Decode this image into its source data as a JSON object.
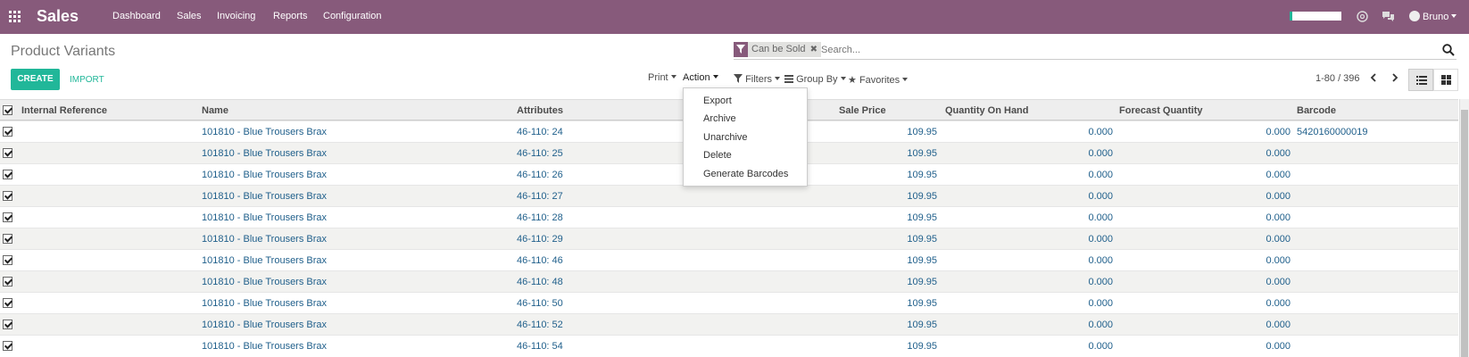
{
  "navbar": {
    "brand": "Sales",
    "menu": [
      "Dashboard",
      "Sales",
      "Invoicing",
      "Reports",
      "Configuration"
    ],
    "user": "Bruno",
    "accent": "#875a7b"
  },
  "control_panel": {
    "title": "Product Variants",
    "search": {
      "facet": "Can be Sold",
      "placeholder": "Search..."
    },
    "create_label": "CREATE",
    "import_label": "IMPORT",
    "print_label": "Print",
    "action_label": "Action",
    "filters_label": "Filters",
    "groupby_label": "Group By",
    "favorites_label": "Favorites",
    "pager": "1-80 / 396"
  },
  "action_menu": [
    "Export",
    "Archive",
    "Unarchive",
    "Delete",
    "Generate Barcodes"
  ],
  "table": {
    "headers": [
      "Internal Reference",
      "Name",
      "Attributes",
      "Sale Price",
      "Quantity On Hand",
      "Forecast Quantity",
      "Barcode"
    ],
    "rows": [
      {
        "ref": "",
        "name": "101810 - Blue Trousers Brax",
        "attr": "46-110: 24",
        "price": "109.95",
        "qty": "0.000",
        "forecast": "0.000",
        "barcode": "5420160000019"
      },
      {
        "ref": "",
        "name": "101810 - Blue Trousers Brax",
        "attr": "46-110: 25",
        "price": "109.95",
        "qty": "0.000",
        "forecast": "0.000",
        "barcode": ""
      },
      {
        "ref": "",
        "name": "101810 - Blue Trousers Brax",
        "attr": "46-110: 26",
        "price": "109.95",
        "qty": "0.000",
        "forecast": "0.000",
        "barcode": ""
      },
      {
        "ref": "",
        "name": "101810 - Blue Trousers Brax",
        "attr": "46-110: 27",
        "price": "109.95",
        "qty": "0.000",
        "forecast": "0.000",
        "barcode": ""
      },
      {
        "ref": "",
        "name": "101810 - Blue Trousers Brax",
        "attr": "46-110: 28",
        "price": "109.95",
        "qty": "0.000",
        "forecast": "0.000",
        "barcode": ""
      },
      {
        "ref": "",
        "name": "101810 - Blue Trousers Brax",
        "attr": "46-110: 29",
        "price": "109.95",
        "qty": "0.000",
        "forecast": "0.000",
        "barcode": ""
      },
      {
        "ref": "",
        "name": "101810 - Blue Trousers Brax",
        "attr": "46-110: 46",
        "price": "109.95",
        "qty": "0.000",
        "forecast": "0.000",
        "barcode": ""
      },
      {
        "ref": "",
        "name": "101810 - Blue Trousers Brax",
        "attr": "46-110: 48",
        "price": "109.95",
        "qty": "0.000",
        "forecast": "0.000",
        "barcode": ""
      },
      {
        "ref": "",
        "name": "101810 - Blue Trousers Brax",
        "attr": "46-110: 50",
        "price": "109.95",
        "qty": "0.000",
        "forecast": "0.000",
        "barcode": ""
      },
      {
        "ref": "",
        "name": "101810 - Blue Trousers Brax",
        "attr": "46-110: 52",
        "price": "109.95",
        "qty": "0.000",
        "forecast": "0.000",
        "barcode": ""
      },
      {
        "ref": "",
        "name": "101810 - Blue Trousers Brax",
        "attr": "46-110: 54",
        "price": "109.95",
        "qty": "0.000",
        "forecast": "0.000",
        "barcode": ""
      }
    ]
  }
}
